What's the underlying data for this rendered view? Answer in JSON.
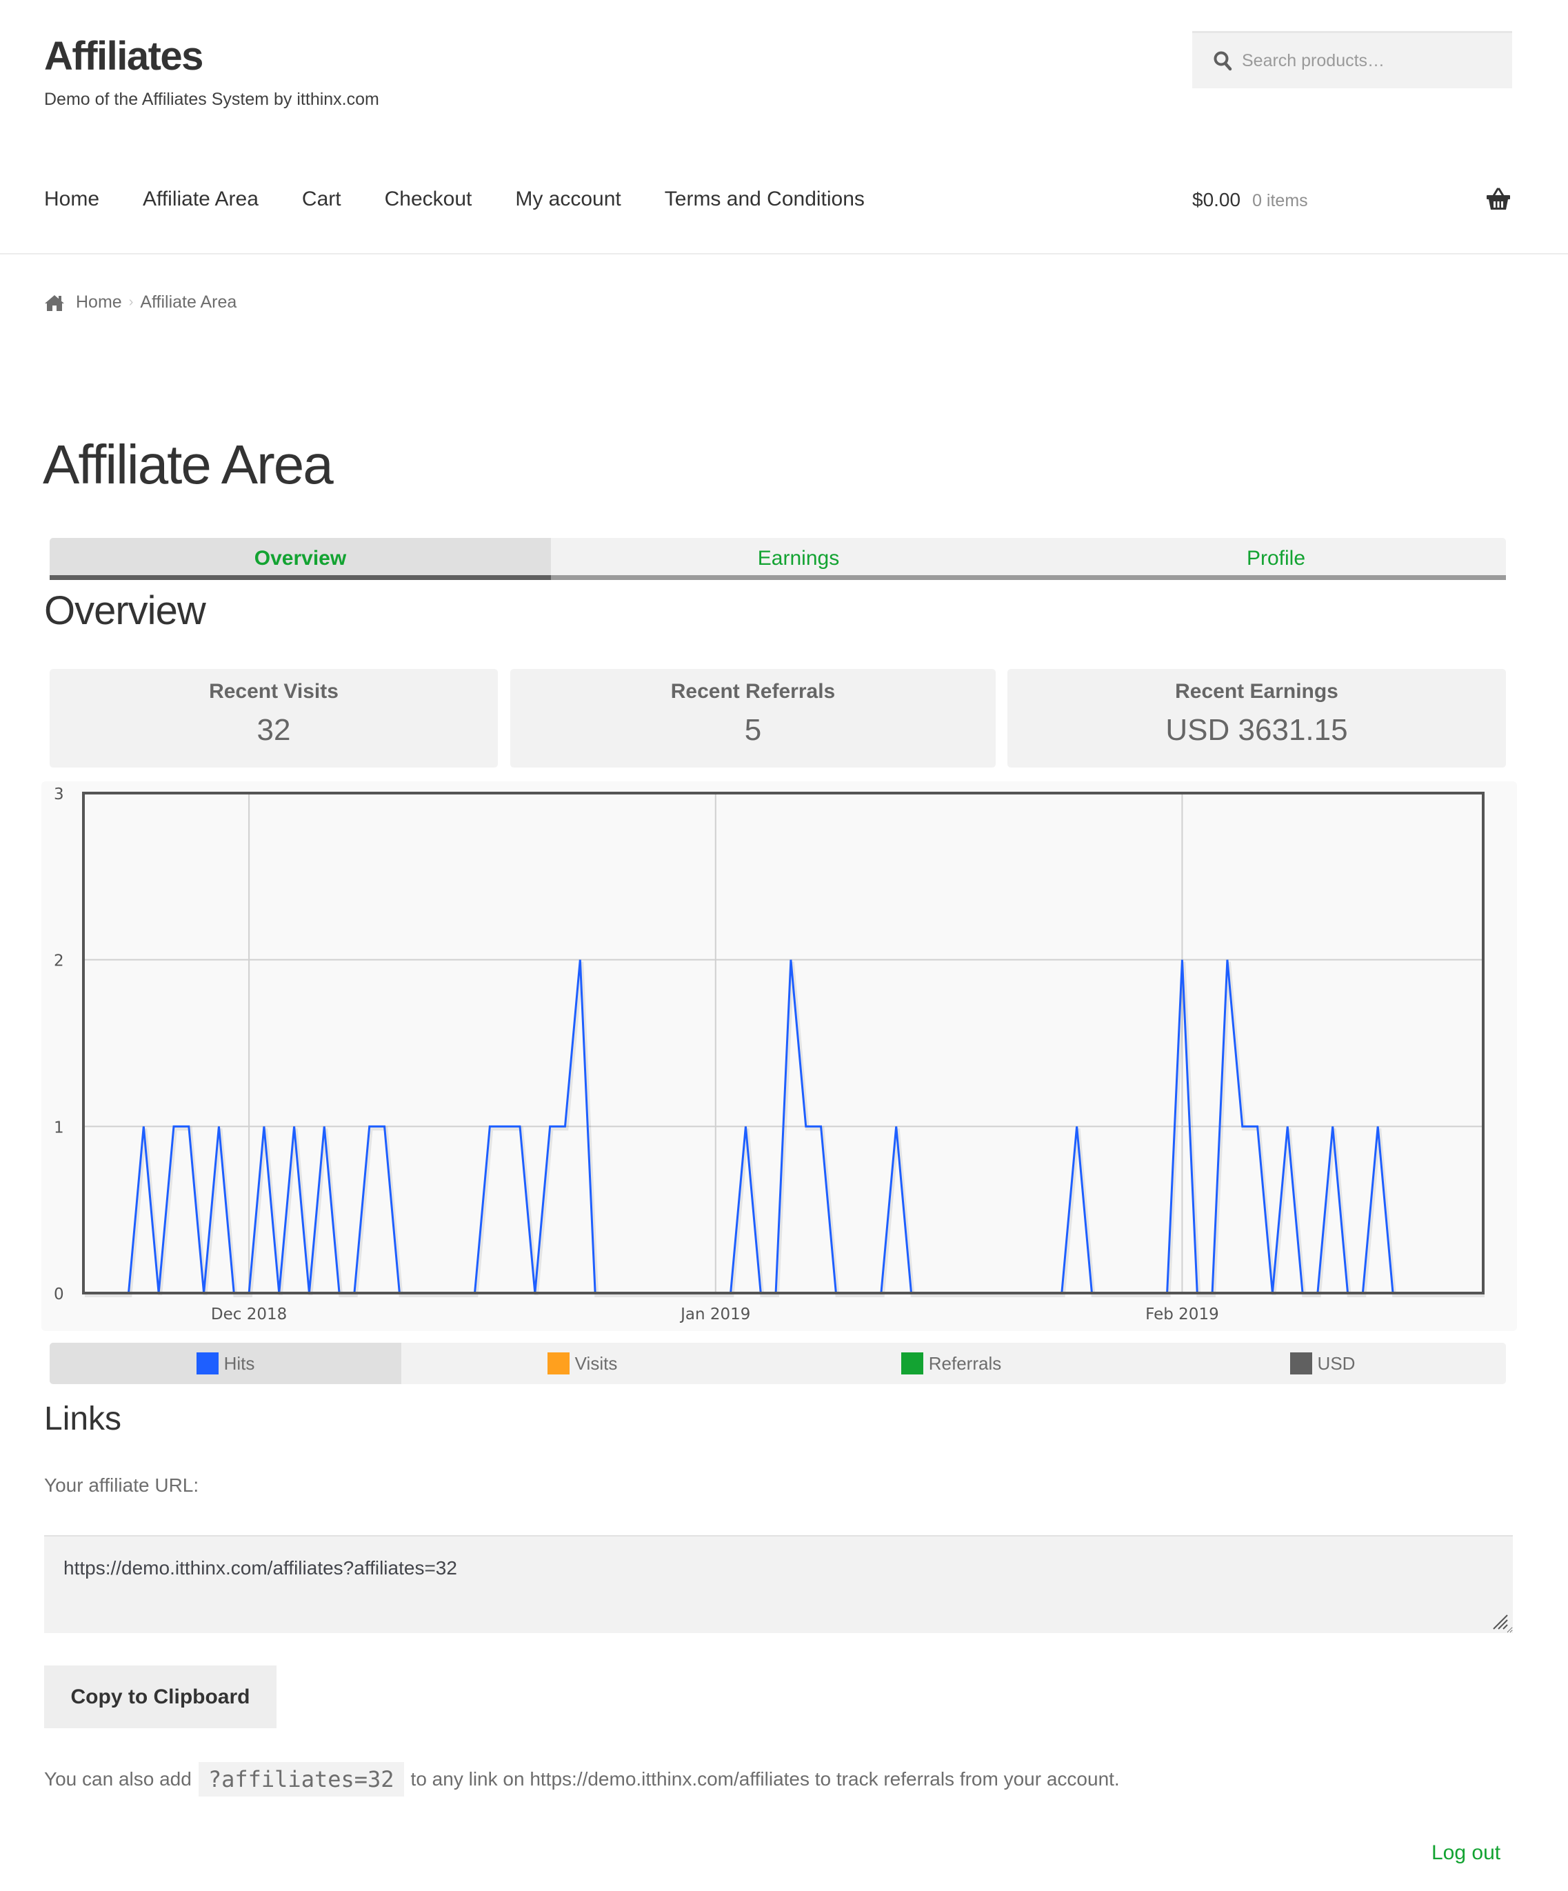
{
  "site": {
    "title": "Affiliates",
    "tagline": "Demo of the Affiliates System by itthinx.com"
  },
  "search": {
    "placeholder": "Search products…",
    "icon": "search-icon"
  },
  "nav": {
    "items": [
      {
        "label": "Home"
      },
      {
        "label": "Affiliate Area"
      },
      {
        "label": "Cart"
      },
      {
        "label": "Checkout"
      },
      {
        "label": "My account"
      },
      {
        "label": "Terms and Conditions"
      }
    ]
  },
  "cart": {
    "total": "$0.00",
    "count": "0 items",
    "icon": "basket-icon"
  },
  "breadcrumb": {
    "icon": "home-icon",
    "items": [
      {
        "label": "Home"
      },
      {
        "label": "Affiliate Area"
      }
    ],
    "separator": "›"
  },
  "page": {
    "title": "Affiliate Area"
  },
  "tabs": [
    {
      "label": "Overview",
      "active": true
    },
    {
      "label": "Earnings",
      "active": false
    },
    {
      "label": "Profile",
      "active": false
    }
  ],
  "overview": {
    "title": "Overview",
    "stats": [
      {
        "label": "Recent Visits",
        "value": "32"
      },
      {
        "label": "Recent Referrals",
        "value": "5"
      },
      {
        "label": "Recent Earnings",
        "value": "USD 3631.15"
      }
    ]
  },
  "colors": {
    "accent": "#13a332",
    "hits": "#1e5fff",
    "visits": "#ffa01e",
    "referrals": "#13a332",
    "usd": "#606060"
  },
  "chart_data": {
    "type": "line",
    "title": "",
    "xlabel": "",
    "ylabel": "",
    "x_start": "2018-11-20",
    "x_end": "2019-02-21",
    "x_ticks": [
      {
        "label": "Dec 2018",
        "index": 11
      },
      {
        "label": "Jan 2019",
        "index": 42
      },
      {
        "label": "Feb 2019",
        "index": 73
      }
    ],
    "y_ticks": [
      "0",
      "1",
      "2",
      "3"
    ],
    "ylim": [
      0,
      3
    ],
    "grid": true,
    "legend_placement": "bottom",
    "series": [
      {
        "name": "Hits",
        "color": "#1e5fff",
        "visible": true,
        "values": [
          0,
          0,
          0,
          0,
          1,
          0,
          1,
          1,
          0,
          1,
          0,
          0,
          1,
          0,
          1,
          0,
          1,
          0,
          0,
          1,
          1,
          0,
          0,
          0,
          0,
          0,
          0,
          1,
          1,
          1,
          0,
          1,
          1,
          2,
          0,
          0,
          0,
          0,
          0,
          0,
          0,
          0,
          0,
          0,
          1,
          0,
          0,
          2,
          1,
          1,
          0,
          0,
          0,
          0,
          1,
          0,
          0,
          0,
          0,
          0,
          0,
          0,
          0,
          0,
          0,
          0,
          1,
          0,
          0,
          0,
          0,
          0,
          0,
          2,
          0,
          0,
          2,
          1,
          1,
          0,
          1,
          0,
          0,
          1,
          0,
          0,
          1,
          0,
          0,
          0,
          0,
          0,
          0,
          0
        ]
      },
      {
        "name": "Visits",
        "color": "#ffa01e",
        "visible": false
      },
      {
        "name": "Referrals",
        "color": "#13a332",
        "visible": false
      },
      {
        "name": "USD",
        "color": "#606060",
        "visible": false
      }
    ]
  },
  "legend": [
    {
      "label": "Hits",
      "color": "#1e5fff",
      "active": true
    },
    {
      "label": "Visits",
      "color": "#ffa01e",
      "active": false
    },
    {
      "label": "Referrals",
      "color": "#13a332",
      "active": false
    },
    {
      "label": "USD",
      "color": "#606060",
      "active": false
    }
  ],
  "links": {
    "title": "Links",
    "url_label": "Your affiliate URL:",
    "url_value": "https://demo.itthinx.com/affiliates?affiliates=32",
    "copy_label": "Copy to Clipboard",
    "hint_before": "You can also add",
    "hint_code": "?affiliates=32",
    "hint_after": "to any link on https://demo.itthinx.com/affiliates to track referrals from your account."
  },
  "footer": {
    "logout_label": "Log out"
  }
}
